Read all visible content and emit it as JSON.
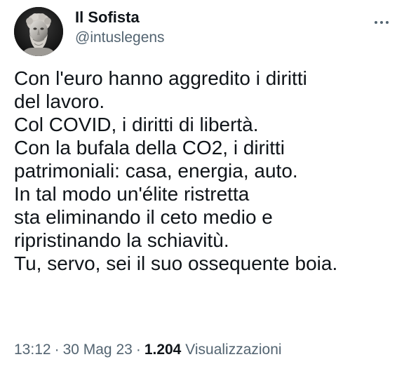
{
  "author": {
    "display_name": "Il Sofista",
    "handle": "@intuslegens",
    "avatar_icon": "marble-bust-avatar"
  },
  "more_icon": "more-dots-icon",
  "tweet": {
    "lines": [
      "Con l'euro hanno aggredito i diritti",
      "del lavoro.",
      "Col COVID, i diritti di libertà.",
      "Con la bufala della CO2, i diritti",
      "patrimoniali: casa, energia, auto.",
      "In tal modo un'élite ristretta",
      "sta eliminando il ceto medio e",
      "ripristinando la schiavitù.",
      "Tu, servo, sei il suo ossequente boia."
    ]
  },
  "meta": {
    "time": "13:12",
    "separator": "·",
    "date": "30 Mag 23",
    "views_count": "1.204",
    "views_label": "Visualizzazioni"
  },
  "colors": {
    "text_primary": "#0f1419",
    "text_secondary": "#536471",
    "background": "#ffffff"
  }
}
